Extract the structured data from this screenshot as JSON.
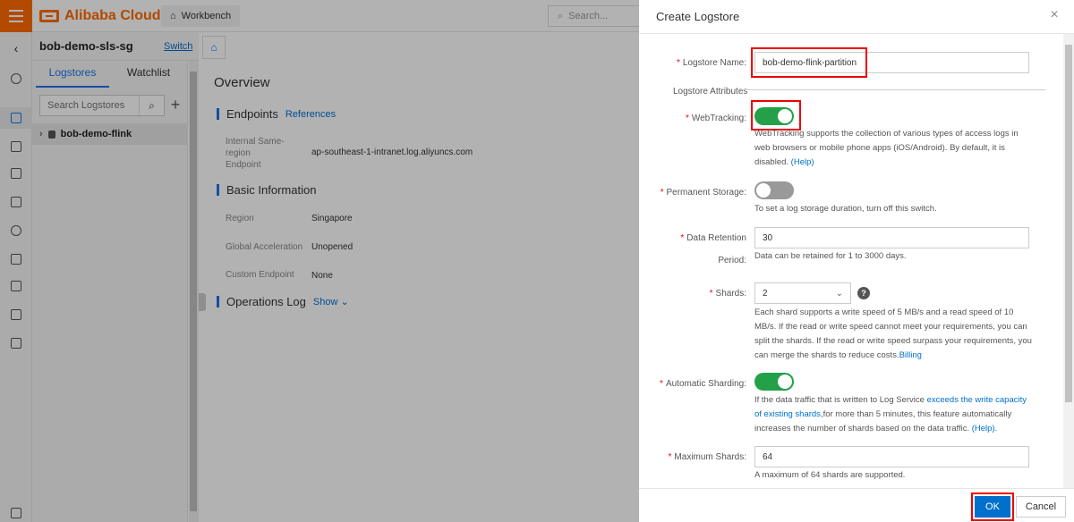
{
  "topbar": {
    "brand": "Alibaba Cloud",
    "workbench_label": "Workbench",
    "search_placeholder": "Search..."
  },
  "project": {
    "name": "bob-demo-sls-sg",
    "switch_label": "Switch"
  },
  "logstore_panel": {
    "tabs": [
      {
        "label": "Logstores",
        "active": true
      },
      {
        "label": "Watchlist",
        "active": false
      }
    ],
    "search_placeholder": "Search Logstores",
    "items": [
      {
        "label": "bob-demo-flink"
      }
    ]
  },
  "overview": {
    "title": "Overview",
    "endpoints": {
      "heading": "Endpoints",
      "references_link": "References",
      "rows": [
        {
          "label": "Internal Same-region Endpoint",
          "value": "ap-southeast-1-intranet.log.aliyuncs.com"
        }
      ]
    },
    "basic_info": {
      "heading": "Basic Information",
      "rows": [
        {
          "label": "Region",
          "value": "Singapore"
        },
        {
          "label": "Global Acceleration",
          "value": "Unopened"
        },
        {
          "label": "Custom Endpoint",
          "value": "None"
        }
      ]
    },
    "ops_log": {
      "heading": "Operations Log",
      "show_link": "Show"
    }
  },
  "dialog": {
    "title": "Create Logstore",
    "logstore_name": {
      "label": "Logstore Name:",
      "value": "bob-demo-flink-partition"
    },
    "attributes_label": "Logstore Attributes",
    "webtracking": {
      "label": "WebTracking:",
      "enabled": true,
      "help": "WebTracking supports the collection of various types of access logs in web browsers or mobile phone apps (iOS/Android). By default, it is disabled.",
      "help_link": "(Help)"
    },
    "permanent_storage": {
      "label": "Permanent Storage:",
      "enabled": false,
      "help": "To set a log storage duration, turn off this switch."
    },
    "data_retention": {
      "label_line1": "Data Retention",
      "label_line2": "Period:",
      "value": "30",
      "help": "Data can be retained for 1 to 3000 days."
    },
    "shards": {
      "label": "Shards:",
      "value": "2",
      "help": "Each shard supports a write speed of 5 MB/s and a read speed of 10 MB/s. If the read or write speed cannot meet your requirements, you can split the shards. If the read or write speed surpass your requirements, you can merge the shards to reduce costs.",
      "help_link": "Billing"
    },
    "auto_sharding": {
      "label": "Automatic Sharding:",
      "enabled": true,
      "help_prefix": "If the data traffic that is written to Log Service ",
      "help_link1": "exceeds the write capacity of existing shards",
      "help_suffix": ",for more than 5 minutes, this feature automatically increases the number of shards based on the data traffic.",
      "help_link2": "(Help)."
    },
    "max_shards": {
      "label": "Maximum Shards:",
      "value": "64",
      "help": "A maximum of 64 shards are supported."
    },
    "ok_label": "OK",
    "cancel_label": "Cancel"
  },
  "colors": {
    "brand_orange": "#ff6a00",
    "primary_blue": "#0070cc",
    "toggle_on": "#24a148",
    "highlight_red": "#e00000"
  }
}
